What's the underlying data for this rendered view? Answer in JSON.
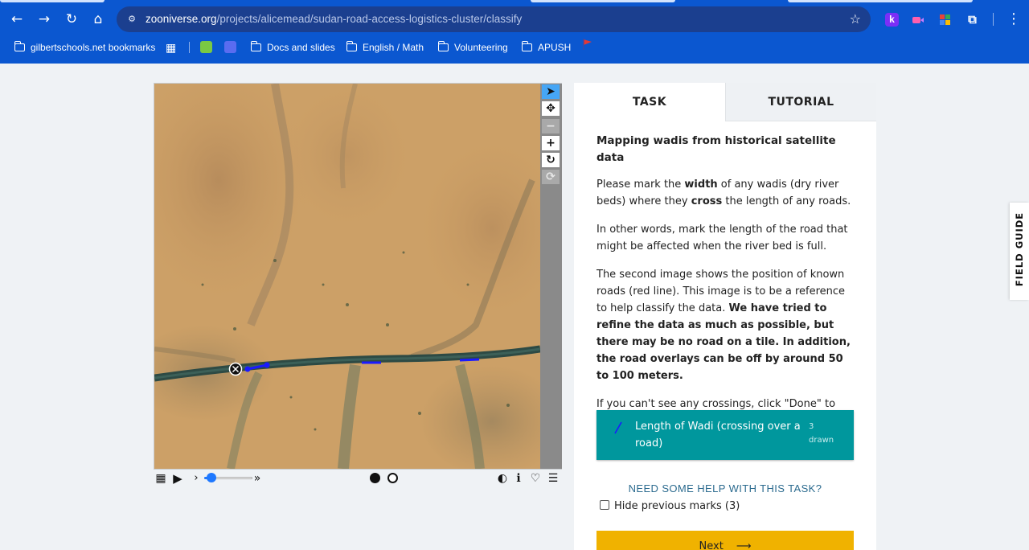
{
  "browser": {
    "url_host": "zooniverse.org",
    "url_path": "/projects/alicemead/sudan-road-access-logistics-cluster/classify",
    "extensions": [
      "k"
    ],
    "bookmarks": [
      {
        "label": "gilbertschools.net bookmarks"
      },
      {
        "label": "Docs and slides"
      },
      {
        "label": "English / Math"
      },
      {
        "label": "Volunteering"
      },
      {
        "label": "APUSH"
      }
    ]
  },
  "viewer": {
    "toolbar": [
      "pointer-icon",
      "move-icon",
      "zoom-out-icon",
      "zoom-in-icon",
      "rotate-icon",
      "reset-icon"
    ],
    "controls": {
      "slider_value": 0.15
    }
  },
  "tabs": {
    "task": "TASK",
    "tutorial": "TUTORIAL"
  },
  "task": {
    "heading": "Mapping wadis from historical satellite data",
    "p1_a": "Please mark the ",
    "p1_b": "width",
    "p1_c": " of any wadis (dry river beds) where they ",
    "p1_d": "cross",
    "p1_e": " the length of any roads.",
    "p2": "In other words, mark the length of the road that might be affected when the river bed is full.",
    "p3_a": "The second image shows the position of known roads (red line). This image is to be a reference to help classify the data. ",
    "p3_b": "We have tried to refine the data as much as possible, but there may be no road on a tile. In addition, the road overlays can be off by around 50 to 100 meters.",
    "p4": "If you can't see any crossings, click \"Done\" to move on to the next image.",
    "tool_label": "Length of Wadi (crossing over a road)",
    "tool_count": "3",
    "tool_count_suffix": "drawn",
    "help": "NEED SOME HELP WITH THIS TASK?",
    "hide_marks": "Hide previous marks (3)",
    "next": "Next"
  },
  "field_guide": "FIELD GUIDE",
  "colors": {
    "chrome": "#0b57d0",
    "tool_button": "#00979d",
    "next_button": "#f0b200",
    "help_link": "#2c6b8f"
  }
}
